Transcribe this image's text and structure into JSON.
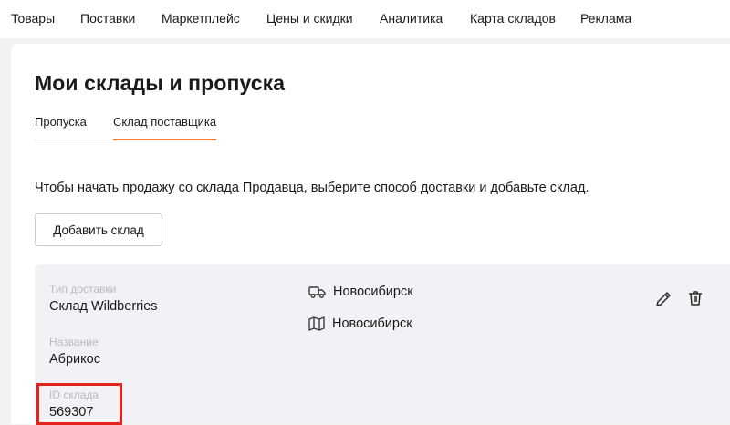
{
  "topnav": {
    "items": [
      "Товары",
      "Поставки",
      "Маркетплейс",
      "Цены и скидки",
      "Аналитика",
      "Карта складов",
      "Реклама"
    ]
  },
  "page": {
    "title": "Мои склады и пропуска",
    "tabs": [
      {
        "label": "Пропуска",
        "active": false
      },
      {
        "label": "Склад поставщика",
        "active": true
      }
    ],
    "intro": "Чтобы начать продажу со склада Продавца, выберите способ доставки и добавьте склад.",
    "add_button": "Добавить склад"
  },
  "warehouse": {
    "delivery_type_label": "Тип доставки",
    "delivery_type_value": "Склад Wildberries",
    "name_label": "Название",
    "name_value": "Абрикос",
    "id_label": "ID склада",
    "id_value": "569307",
    "delivery_city": "Новосибирск",
    "map_city": "Новосибирск",
    "icons": {
      "delivery": "truck-icon",
      "map": "map-icon",
      "edit": "pencil-icon",
      "delete": "trash-icon"
    }
  },
  "colors": {
    "accent_tab": "#f07c3e",
    "highlight": "#e3241b",
    "label_gray": "#b9b9c0"
  }
}
